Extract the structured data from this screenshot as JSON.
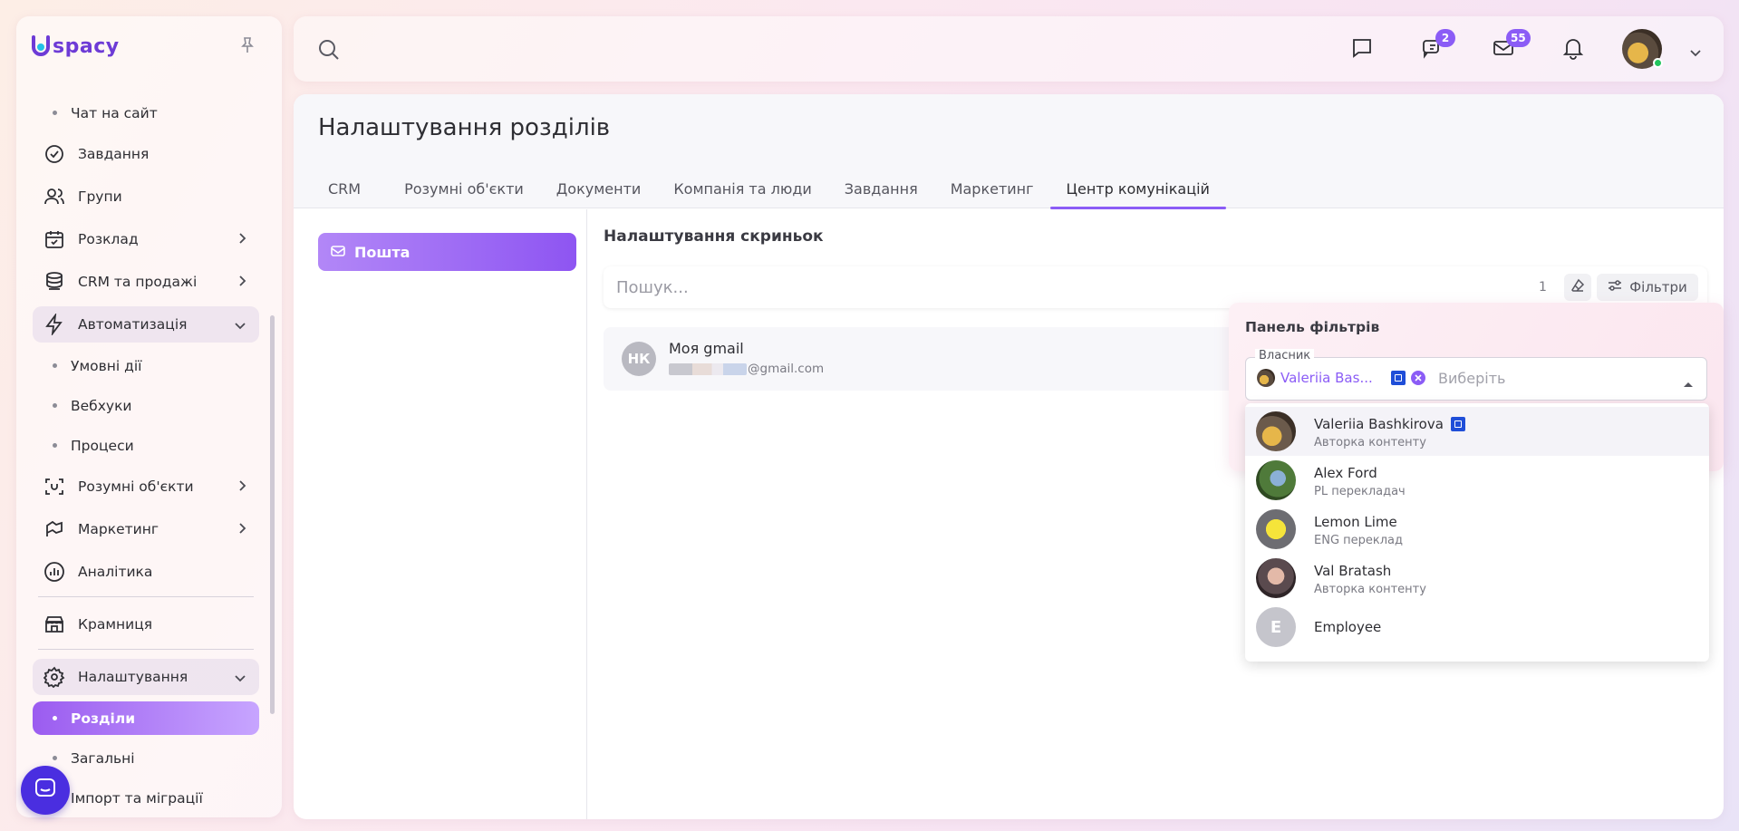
{
  "app": {
    "logo_text": "spacy"
  },
  "sidebar": {
    "items": [
      {
        "type": "sub",
        "label": "Чат на сайт"
      },
      {
        "type": "item",
        "label": "Завдання",
        "icon": "check-circle-icon"
      },
      {
        "type": "item",
        "label": "Групи",
        "icon": "users-icon"
      },
      {
        "type": "item",
        "label": "Розклад",
        "icon": "calendar-icon",
        "expandable": true
      },
      {
        "type": "item",
        "label": "CRM та продажі",
        "icon": "database-icon",
        "expandable": true
      },
      {
        "type": "item",
        "label": "Автоматизація",
        "icon": "lightning-icon",
        "expandable": true,
        "open": true
      },
      {
        "type": "sub",
        "label": "Умовні дії"
      },
      {
        "type": "sub",
        "label": "Вебхуки"
      },
      {
        "type": "sub",
        "label": "Процеси"
      },
      {
        "type": "item",
        "label": "Розумні об'єкти",
        "icon": "smart-object-icon",
        "expandable": true
      },
      {
        "type": "item",
        "label": "Маркетинг",
        "icon": "marketing-icon",
        "expandable": true
      },
      {
        "type": "item",
        "label": "Аналітика",
        "icon": "analytics-icon"
      },
      {
        "type": "item",
        "label": "Крамниця",
        "icon": "store-icon"
      },
      {
        "type": "item",
        "label": "Налаштування",
        "icon": "gear-icon",
        "expandable": true,
        "open": true
      },
      {
        "type": "sub",
        "label": "Розділи",
        "active": true
      },
      {
        "type": "sub",
        "label": "Загальні"
      },
      {
        "type": "sub",
        "label": "Імпорт та міграції"
      }
    ]
  },
  "topbar": {
    "chats_badge": "2",
    "mail_badge": "55"
  },
  "page": {
    "title": "Налаштування розділів",
    "tabs": [
      {
        "label": "CRM"
      },
      {
        "label": "Розумні об'єкти"
      },
      {
        "label": "Документи"
      },
      {
        "label": "Компанія та люди"
      },
      {
        "label": "Завдання"
      },
      {
        "label": "Маркетинг"
      },
      {
        "label": "Центр комунікацій",
        "active": true
      }
    ],
    "left_menu": {
      "mail_label": "Пошта"
    }
  },
  "mailboxes": {
    "section_title": "Налаштування скриньок",
    "search_placeholder": "Пошук...",
    "count": "1",
    "filters_label": "Фільтри",
    "items": [
      {
        "initials": "НК",
        "name": "Моя gmail",
        "email_suffix": "@gmail.com"
      }
    ]
  },
  "filter_panel": {
    "title": "Панель фільтрів",
    "owner_label": "Власник",
    "selected_chip": "Valeriia Bas...",
    "placeholder": "Виберіть",
    "options": [
      {
        "name": "Valeriia Bashkirova",
        "role": "Авторка контенту",
        "employee_badge": true,
        "highlight": true
      },
      {
        "name": "Alex Ford",
        "role": "PL перекладач"
      },
      {
        "name": "Lemon Lime",
        "role": "ENG переклад"
      },
      {
        "name": "Val Bratash",
        "role": "Авторка контенту"
      },
      {
        "name": "Employee",
        "initial": "E"
      }
    ]
  },
  "colors": {
    "accent": "#8b5cf6",
    "fab": "#4a2ee0",
    "online": "#22c55e"
  }
}
